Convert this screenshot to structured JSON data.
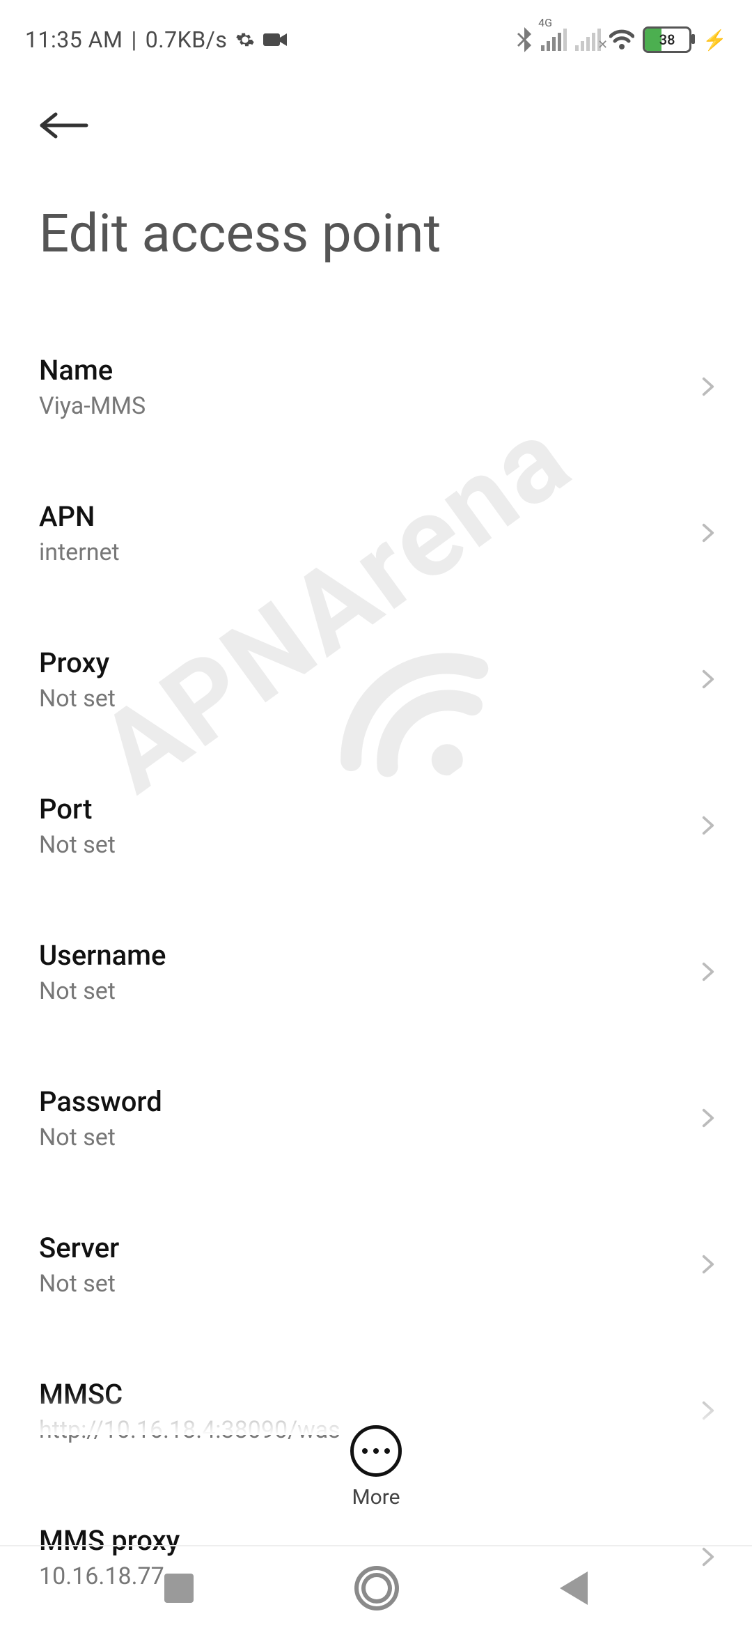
{
  "status": {
    "time": "11:35 AM",
    "net_speed": "0.7KB/s",
    "sim1_tech": "4G",
    "battery_pct": "38"
  },
  "header": {
    "title": "Edit access point"
  },
  "rows": [
    {
      "title": "Name",
      "value": "Viya-MMS"
    },
    {
      "title": "APN",
      "value": "internet"
    },
    {
      "title": "Proxy",
      "value": "Not set"
    },
    {
      "title": "Port",
      "value": "Not set"
    },
    {
      "title": "Username",
      "value": "Not set"
    },
    {
      "title": "Password",
      "value": "Not set"
    },
    {
      "title": "Server",
      "value": "Not set"
    },
    {
      "title": "MMSC",
      "value": "http://10.16.18.4:38090/was"
    },
    {
      "title": "MMS proxy",
      "value": "10.16.18.77"
    }
  ],
  "more_label": "More",
  "watermark_text": "APNArena"
}
